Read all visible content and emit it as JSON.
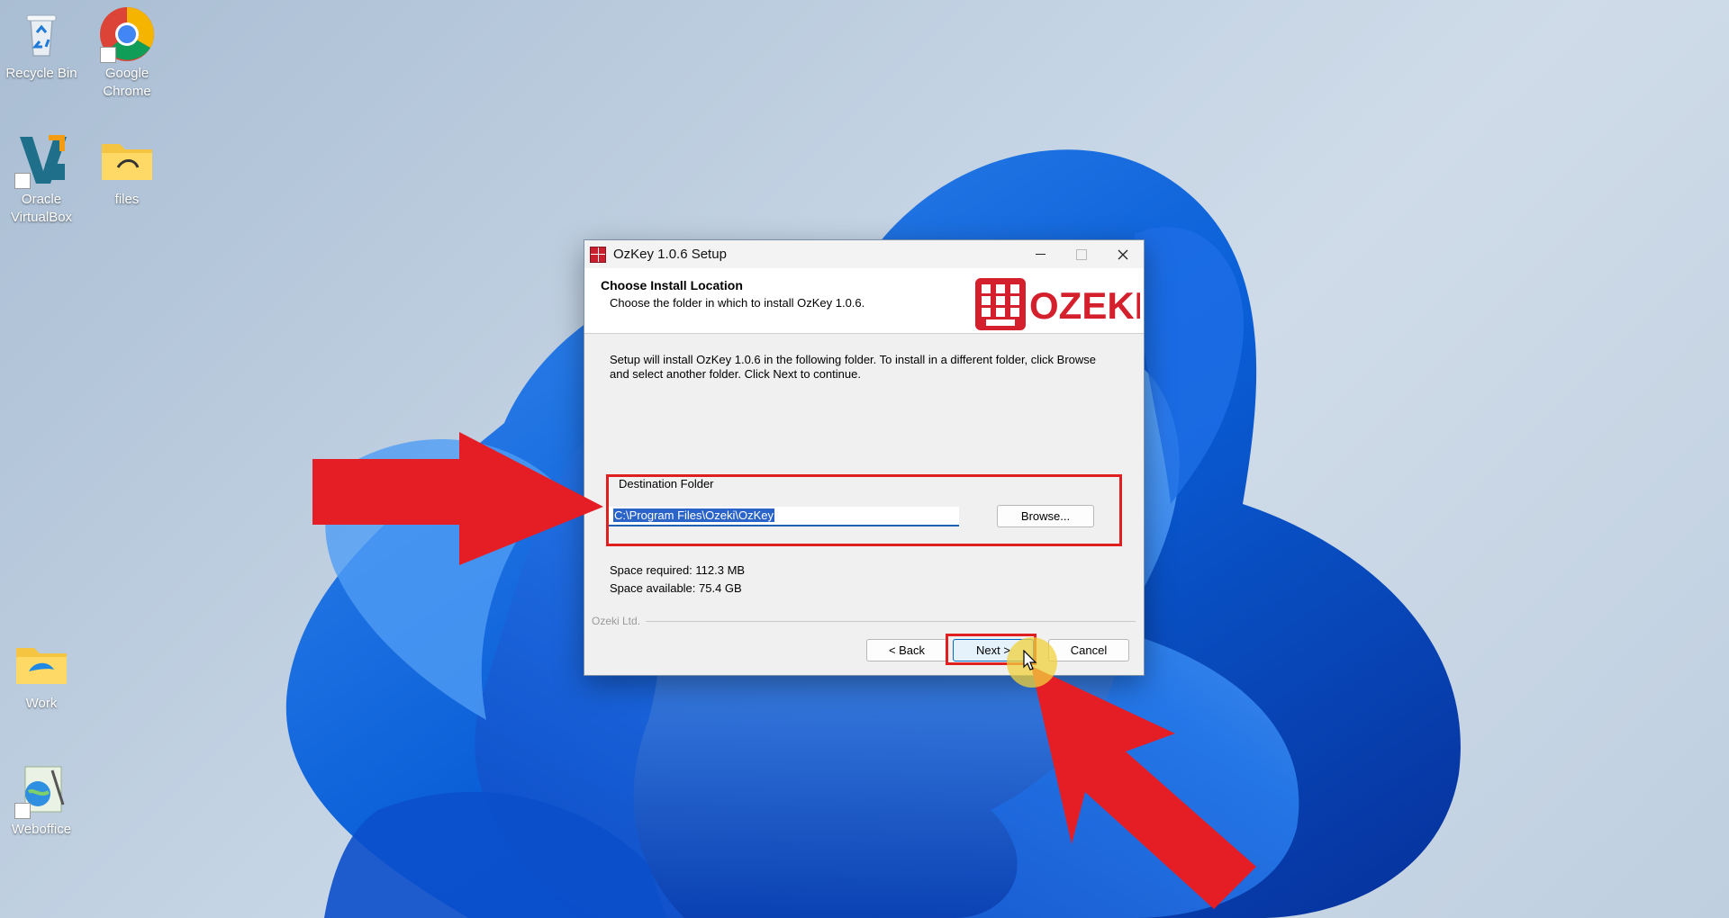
{
  "desktop": {
    "icons": [
      {
        "label": "Recycle Bin"
      },
      {
        "label": "Google Chrome"
      },
      {
        "label": "Oracle VirtualBox"
      },
      {
        "label": "files"
      },
      {
        "label": "Work"
      },
      {
        "label": "Weboffice"
      }
    ]
  },
  "dialog": {
    "title": "OzKey 1.0.6 Setup",
    "header_title": "Choose Install Location",
    "header_subtitle": "Choose the folder in which to install OzKey 1.0.6.",
    "logo_text": "OZEKI",
    "intro": "Setup will install OzKey 1.0.6 in the following folder. To install in a different folder, click Browse and select another folder. Click Next to continue.",
    "destination_label": "Destination Folder",
    "destination_path": "C:\\Program Files\\Ozeki\\OzKey",
    "browse_label": "Browse...",
    "space_required": "Space required: 112.3 MB",
    "space_available": "Space available: 75.4 GB",
    "brand": "Ozeki Ltd.",
    "back_label": "< Back",
    "next_label": "Next >",
    "cancel_label": "Cancel"
  },
  "colors": {
    "highlight": "#e02020",
    "selection": "#2a64c8",
    "logo_red": "#d4202c"
  },
  "icon_names": [
    "recycle-bin-icon",
    "chrome-icon",
    "virtualbox-icon",
    "folder-icon",
    "minimize-icon",
    "maximize-icon",
    "close-icon",
    "arrow-icon",
    "cursor-icon"
  ]
}
